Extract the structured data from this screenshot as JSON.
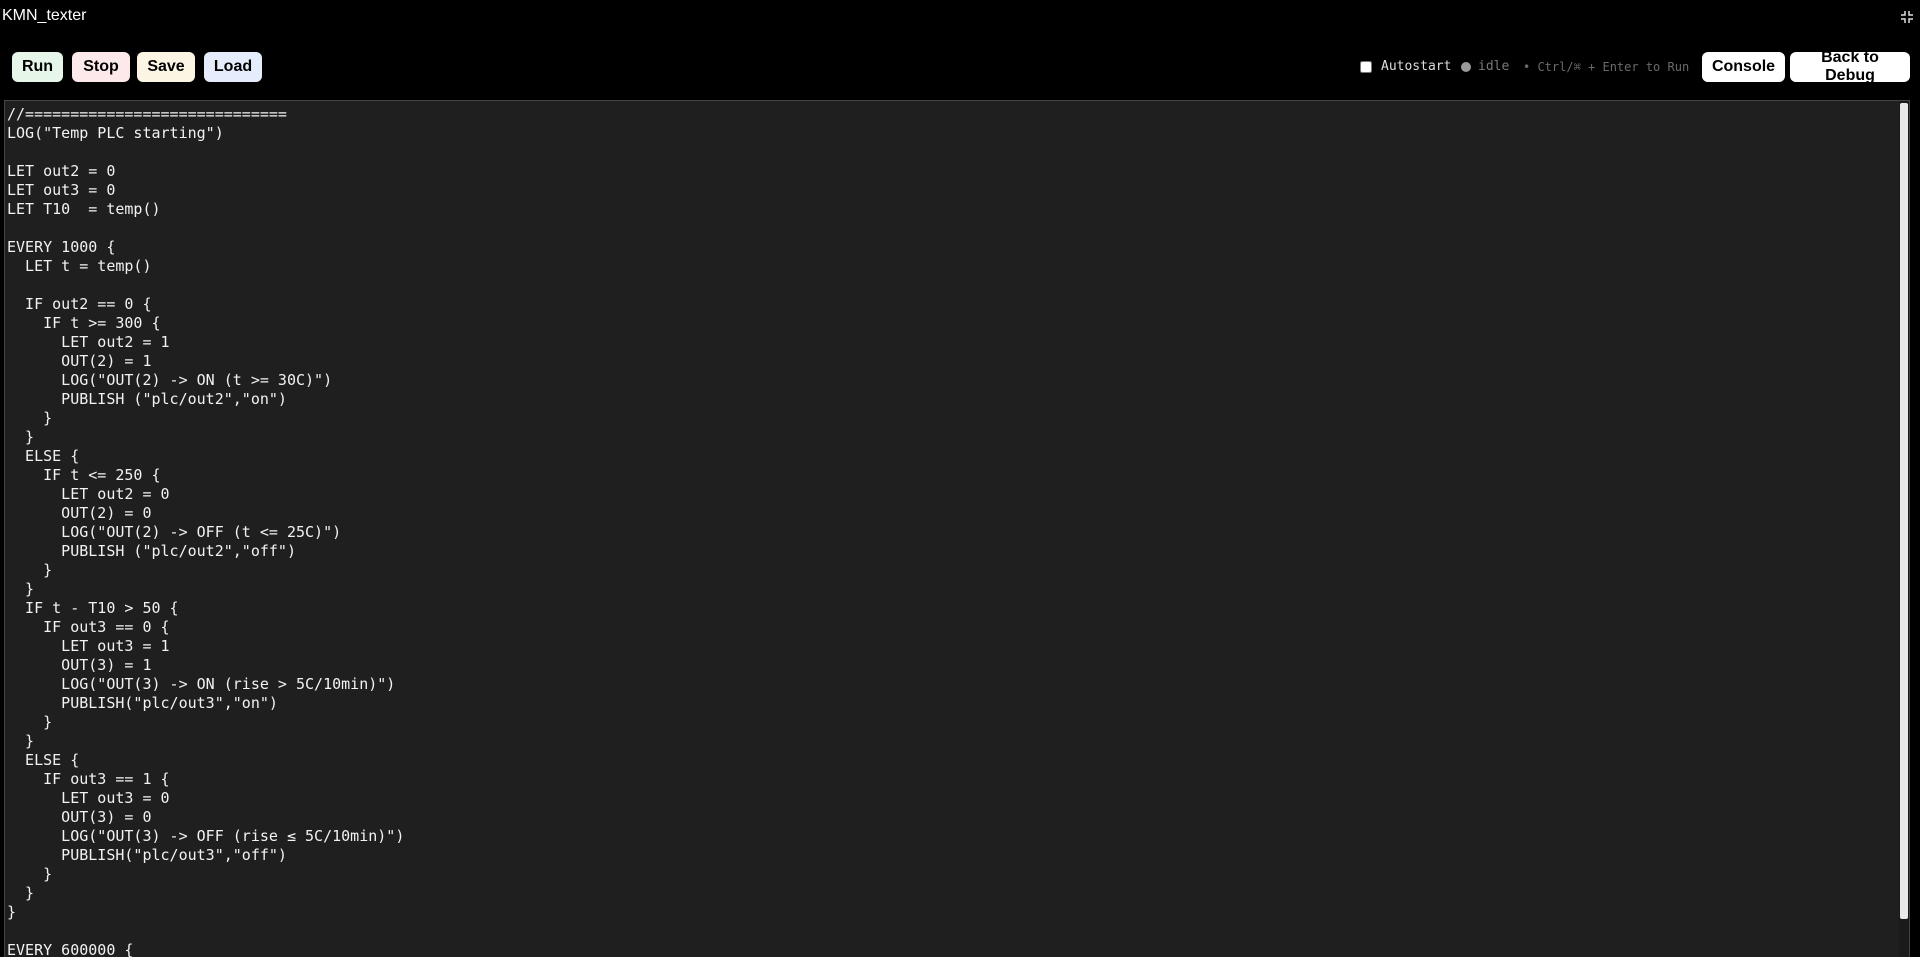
{
  "window": {
    "title": "KMN_texter",
    "fullscreen_icon": "collapse-icon"
  },
  "toolbar": {
    "run_label": "Run",
    "stop_label": "Stop",
    "save_label": "Save",
    "load_label": "Load",
    "autostart_label": "Autostart",
    "autostart_checked": false,
    "status": "idle",
    "hint": "• Ctrl/⌘ + Enter to Run",
    "console_label": "Console",
    "back_label": "Back to Debug"
  },
  "editor": {
    "code": "//=============================\nLOG(\"Temp PLC starting\")\n\nLET out2 = 0\nLET out3 = 0\nLET T10  = temp()\n\nEVERY 1000 {\n  LET t = temp()\n\n  IF out2 == 0 {\n    IF t >= 300 {\n      LET out2 = 1\n      OUT(2) = 1\n      LOG(\"OUT(2) -> ON (t >= 30C)\")\n      PUBLISH (\"plc/out2\",\"on\")\n    }\n  }\n  ELSE {\n    IF t <= 250 {\n      LET out2 = 0\n      OUT(2) = 0\n      LOG(\"OUT(2) -> OFF (t <= 25C)\")\n      PUBLISH (\"plc/out2\",\"off\")\n    }\n  }\n  IF t - T10 > 50 {\n    IF out3 == 0 {\n      LET out3 = 1\n      OUT(3) = 1\n      LOG(\"OUT(3) -> ON (rise > 5C/10min)\")\n      PUBLISH(\"plc/out3\",\"on\")\n    }\n  }\n  ELSE {\n    IF out3 == 1 {\n      LET out3 = 0\n      OUT(3) = 0\n      LOG(\"OUT(3) -> OFF (rise ≤ 5C/10min)\")\n      PUBLISH(\"plc/out3\",\"off\")\n    }\n  }\n}\n\nEVERY 600000 {"
  },
  "colors": {
    "background": "#000000",
    "editor_bg": "#1f1f1f",
    "run_bg": "#e6f7e9",
    "stop_bg": "#fde9e9",
    "save_bg": "#fdf5e4",
    "load_bg": "#e5ecfb"
  }
}
